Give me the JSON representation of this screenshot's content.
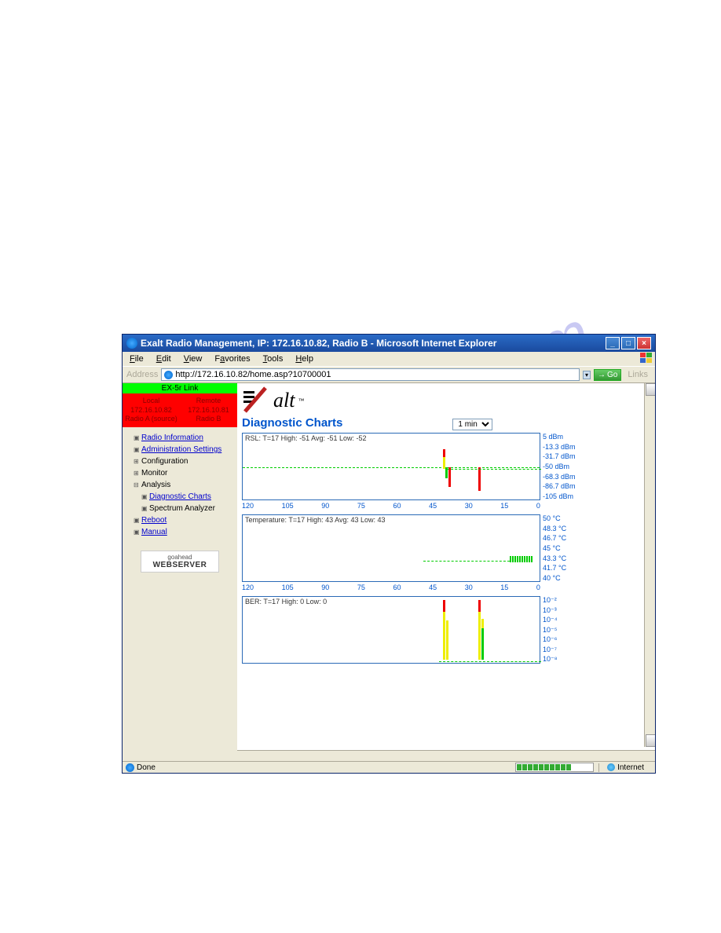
{
  "window": {
    "title": "Exalt Radio Management, IP: 172.16.10.82, Radio B - Microsoft Internet Explorer"
  },
  "menubar": {
    "file": "File",
    "edit": "Edit",
    "view": "View",
    "favorites": "Favorites",
    "tools": "Tools",
    "help": "Help"
  },
  "toolbar": {
    "address_label": "Address",
    "url": "http://172.16.10.82/home.asp?10700001",
    "go": "Go",
    "links": "Links"
  },
  "sidebar": {
    "link_name": "EX-5r Link",
    "local": {
      "label": "Local",
      "ip": "172.16.10.82",
      "name": "Radio A (source)"
    },
    "remote": {
      "label": "Remote",
      "ip": "172.16.10.81",
      "name": "Radio B"
    },
    "nav": {
      "radio_info": "Radio Information",
      "admin": "Administration Settings",
      "config": "Configuration",
      "monitor": "Monitor",
      "analysis": "Analysis",
      "diag_charts": "Diagnostic Charts",
      "spectrum": "Spectrum Analyzer",
      "reboot": "Reboot",
      "manual": "Manual"
    },
    "webserver_top": "goahead",
    "webserver": "WEBSERVER"
  },
  "main": {
    "logo_text": "alt",
    "page_title": "Diagnostic Charts",
    "time_select": "1 min"
  },
  "chart_data": [
    {
      "type": "line",
      "title": "RSL: T=17 High: -51 Avg: -51 Low: -52",
      "xlabel": "",
      "ylabel": "",
      "x_ticks": [
        120,
        105,
        90,
        75,
        60,
        45,
        30,
        15,
        0
      ],
      "y_ticks": [
        "5 dBm",
        "-13.3 dBm",
        "-31.7 dBm",
        "-50 dBm",
        "-68.3 dBm",
        "-86.7 dBm",
        "-105 dBm"
      ],
      "ylim": [
        -105,
        5
      ],
      "reference_line": -50,
      "series": [
        {
          "name": "RSL",
          "points": [
            {
              "x": 40,
              "low": -65,
              "high": -40,
              "color": "mixed"
            },
            {
              "x": 38,
              "low": -80,
              "high": -50,
              "color": "red"
            },
            {
              "x": 30,
              "low": -85,
              "high": -50,
              "color": "red"
            },
            {
              "x": 25,
              "low": -52,
              "high": -50,
              "color": "green"
            }
          ]
        }
      ]
    },
    {
      "type": "line",
      "title": "Temperature: T=17 High: 43 Avg: 43 Low: 43",
      "x_ticks": [
        120,
        105,
        90,
        75,
        60,
        45,
        30,
        15,
        0
      ],
      "y_ticks": [
        "50 °C",
        "48.3 °C",
        "46.7 °C",
        "45 °C",
        "43.3 °C",
        "41.7 °C",
        "40 °C"
      ],
      "ylim": [
        40,
        50
      ],
      "series": [
        {
          "name": "Temp",
          "points": [
            {
              "x": 45,
              "value": 43
            },
            {
              "x": 40,
              "value": 43
            },
            {
              "x": 35,
              "value": 43
            },
            {
              "x": 30,
              "value": 43
            },
            {
              "x": 25,
              "value": 43
            },
            {
              "x": 20,
              "value": 43
            },
            {
              "x": 15,
              "value": 43.3
            },
            {
              "x": 10,
              "value": 43.3
            },
            {
              "x": 5,
              "value": 43.3
            },
            {
              "x": 0,
              "value": 43.3
            }
          ]
        }
      ]
    },
    {
      "type": "line",
      "title": "BER: T=17 High: 0 Low: 0",
      "x_ticks": [
        120,
        105,
        90,
        75,
        60,
        45,
        30,
        15,
        0
      ],
      "y_ticks": [
        "10⁻²",
        "10⁻³",
        "10⁻⁴",
        "10⁻⁵",
        "10⁻⁶",
        "10⁻⁷",
        "10⁻⁸"
      ],
      "series": [
        {
          "name": "BER",
          "points": [
            {
              "x": 40,
              "value": "10⁻²",
              "color": "red-yellow"
            },
            {
              "x": 38,
              "value": "10⁻⁴",
              "color": "yellow"
            },
            {
              "x": 30,
              "value": "10⁻²",
              "color": "red-yellow"
            },
            {
              "x": 28,
              "value": "10⁻⁵",
              "color": "yellow-green"
            }
          ]
        }
      ]
    }
  ],
  "statusbar": {
    "done": "Done",
    "zone": "Internet"
  },
  "watermark": "manualshive.com"
}
